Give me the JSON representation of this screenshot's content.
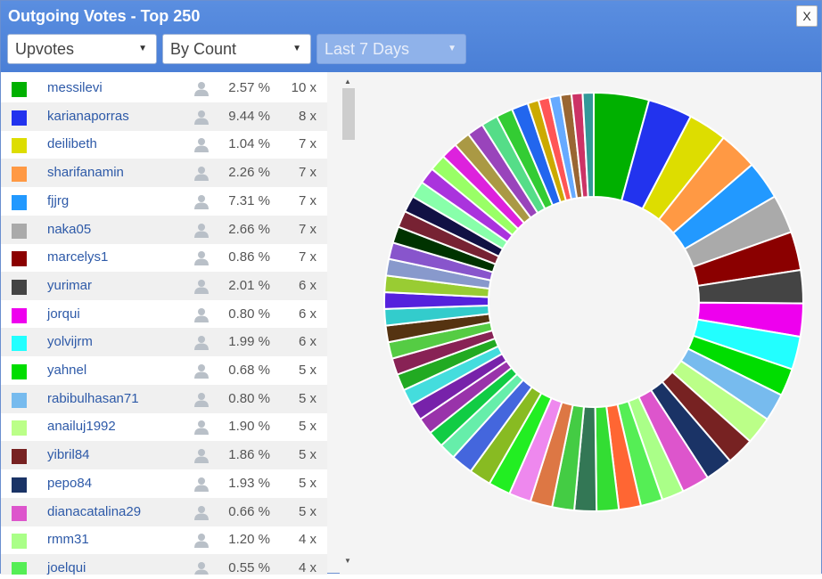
{
  "window": {
    "title": "Outgoing Votes - Top 250",
    "close_label": "X"
  },
  "filters": {
    "type": {
      "selected": "Upvotes"
    },
    "sort": {
      "selected": "By Count"
    },
    "period": {
      "selected": "Last 7 Days"
    }
  },
  "list": {
    "rows": [
      {
        "name": "messilevi",
        "pct": "2.57 %",
        "count": "10 x",
        "color": "#00b000"
      },
      {
        "name": "karianaporras",
        "pct": "9.44 %",
        "count": "8 x",
        "color": "#2233ee"
      },
      {
        "name": "deilibeth",
        "pct": "1.04 %",
        "count": "7 x",
        "color": "#dddd00"
      },
      {
        "name": "sharifanamin",
        "pct": "2.26 %",
        "count": "7 x",
        "color": "#ff9944"
      },
      {
        "name": "fjjrg",
        "pct": "7.31 %",
        "count": "7 x",
        "color": "#2299ff"
      },
      {
        "name": "naka05",
        "pct": "2.66 %",
        "count": "7 x",
        "color": "#aaaaaa"
      },
      {
        "name": "marcelys1",
        "pct": "0.86 %",
        "count": "7 x",
        "color": "#8b0000"
      },
      {
        "name": "yurimar",
        "pct": "2.01 %",
        "count": "6 x",
        "color": "#444444"
      },
      {
        "name": "jorqui",
        "pct": "0.80 %",
        "count": "6 x",
        "color": "#ee00ee"
      },
      {
        "name": "yolvijrm",
        "pct": "1.99 %",
        "count": "6 x",
        "color": "#22ffff"
      },
      {
        "name": "yahnel",
        "pct": "0.68 %",
        "count": "5 x",
        "color": "#00dd00"
      },
      {
        "name": "rabibulhasan71",
        "pct": "0.80 %",
        "count": "5 x",
        "color": "#77bbee"
      },
      {
        "name": "anailuj1992",
        "pct": "1.90 %",
        "count": "5 x",
        "color": "#bbff88"
      },
      {
        "name": "yibril84",
        "pct": "1.86 %",
        "count": "5 x",
        "color": "#772222"
      },
      {
        "name": "pepo84",
        "pct": "1.93 %",
        "count": "5 x",
        "color": "#1a3366"
      },
      {
        "name": "dianacatalina29",
        "pct": "0.66 %",
        "count": "5 x",
        "color": "#dd55cc"
      },
      {
        "name": "rmm31",
        "pct": "1.20 %",
        "count": "4 x",
        "color": "#aaff88"
      },
      {
        "name": "joelqui",
        "pct": "0.55 %",
        "count": "4 x",
        "color": "#55ee55"
      }
    ]
  },
  "icons": {
    "close": "close-icon",
    "caret": "caret-down-icon",
    "person": "user-icon",
    "scroll_up": "scroll-up-arrow-icon",
    "scroll_down": "scroll-down-arrow-icon"
  },
  "chart_data": {
    "type": "pie",
    "style": "donut",
    "values": [
      10,
      8,
      7,
      7,
      7,
      7,
      7,
      6,
      6,
      6,
      5,
      5,
      5,
      5,
      5,
      5,
      4,
      4,
      4,
      4,
      4,
      4,
      4,
      4,
      4,
      4,
      4,
      3,
      3,
      3,
      3,
      3,
      3,
      3,
      3,
      3,
      3,
      3,
      3,
      3,
      3,
      3,
      3,
      3,
      3,
      3,
      3,
      3,
      3,
      3,
      3,
      3,
      3,
      2,
      2,
      2,
      2,
      2,
      2
    ],
    "colors": [
      "#00b000",
      "#2233ee",
      "#dddd00",
      "#ff9944",
      "#2299ff",
      "#aaaaaa",
      "#8b0000",
      "#444444",
      "#ee00ee",
      "#22ffff",
      "#00dd00",
      "#77bbee",
      "#bbff88",
      "#772222",
      "#1a3366",
      "#dd55cc",
      "#aaff88",
      "#55ee55",
      "#ff6633",
      "#33dd33",
      "#337755",
      "#44cc44",
      "#dd7744",
      "#ee88ee",
      "#22ee22",
      "#88bb22",
      "#4466dd",
      "#66eeaa",
      "#11cc44",
      "#9933aa",
      "#7722aa",
      "#44dddd",
      "#22aa22",
      "#882255",
      "#55cc44",
      "#553311",
      "#33cccc",
      "#5522dd",
      "#99cc33",
      "#8899cc",
      "#8855cc",
      "#003300",
      "#772233",
      "#111144",
      "#88ffaa",
      "#aa33dd",
      "#99ff66",
      "#dd22dd",
      "#aa9944",
      "#9944bb",
      "#55dd88",
      "#33cc33",
      "#2266ee",
      "#ccaa00",
      "#ff5555",
      "#66aaff",
      "#996633",
      "#cc3366",
      "#339999"
    ]
  }
}
